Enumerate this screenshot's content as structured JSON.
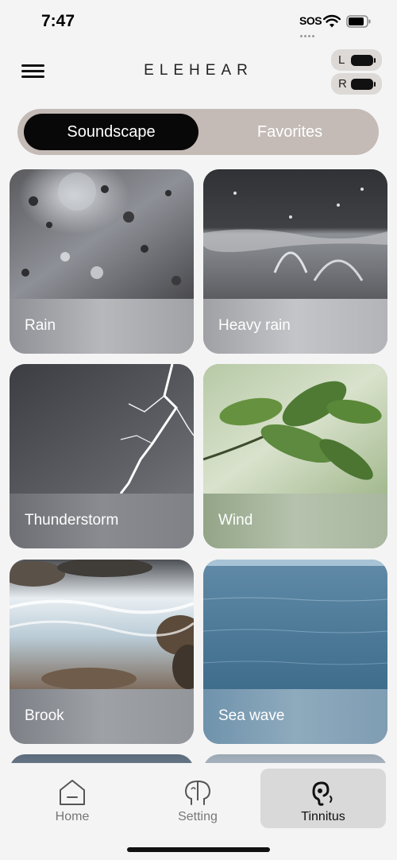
{
  "status_bar": {
    "time": "7:47",
    "sos": "SOS",
    "icons": [
      "wifi-icon",
      "battery-icon"
    ]
  },
  "header": {
    "brand": "ELEHEAR",
    "menu_icon": "hamburger-menu-icon",
    "devices": [
      {
        "side": "L",
        "icon": "battery-icon"
      },
      {
        "side": "R",
        "icon": "battery-icon"
      }
    ]
  },
  "segmented": {
    "tabs": [
      {
        "label": "Soundscape",
        "selected": true
      },
      {
        "label": "Favorites",
        "selected": false
      }
    ]
  },
  "sounds": [
    {
      "label": "Rain"
    },
    {
      "label": "Heavy rain"
    },
    {
      "label": "Thunderstorm"
    },
    {
      "label": "Wind"
    },
    {
      "label": "Brook"
    },
    {
      "label": "Sea wave"
    }
  ],
  "tabbar": {
    "items": [
      {
        "label": "Home",
        "icon": "home-icon",
        "selected": false
      },
      {
        "label": "Setting",
        "icon": "hearing-settings-icon",
        "selected": false
      },
      {
        "label": "Tinnitus",
        "icon": "tinnitus-ear-icon",
        "selected": true
      }
    ]
  },
  "colors": {
    "background": "#f4f4f4",
    "segmented_track": "#c4bab6",
    "segmented_active": "#080808",
    "tab_selected": "#d9d9d9"
  }
}
